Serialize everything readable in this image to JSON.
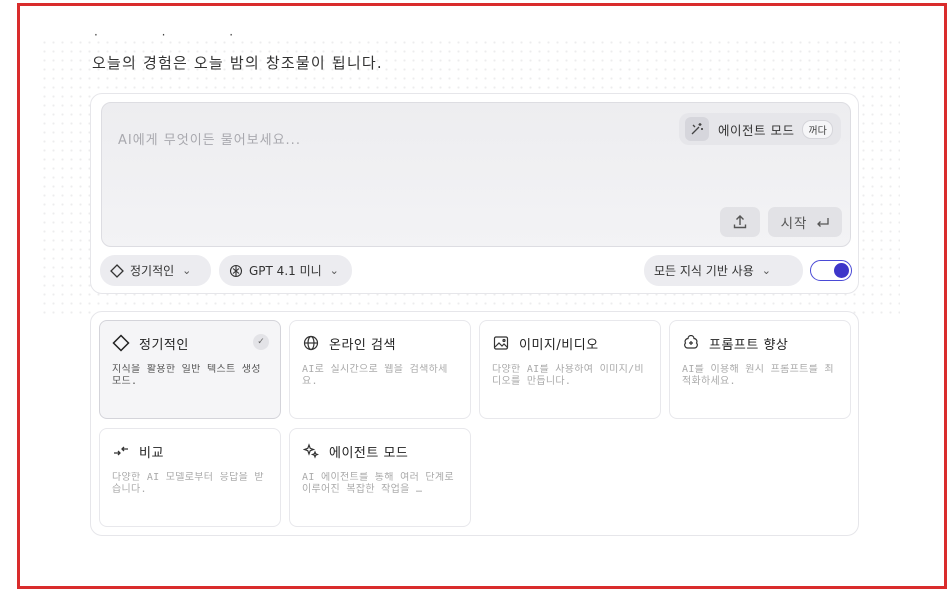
{
  "header": {
    "top_fragment": "· · ·",
    "headline": "오늘의 경험은 오늘 밤의 창조물이 됩니다."
  },
  "prompt": {
    "placeholder": "AI에게 무엇이든 물어보세요...",
    "agent_mode_label": "에이전트 모드",
    "agent_mode_state": "꺼다",
    "start_label": "시작",
    "start_icon": "enter-icon",
    "upload_icon": "upload-icon"
  },
  "controls": {
    "mode_label": "정기적인",
    "model_label": "GPT 4.1 미니",
    "knowledge_label": "모든 지식 기반 사용",
    "toggle_on": true,
    "toggle_color": "#3d36c9"
  },
  "modes": [
    {
      "icon": "diamond-icon",
      "title": "정기적인",
      "desc": "지식을 활용한 일반 텍스트 생성 모드.",
      "selected": true
    },
    {
      "icon": "globe-icon",
      "title": "온라인 검색",
      "desc": "AI로 실시간으로 웹을 검색하세요.",
      "selected": false
    },
    {
      "icon": "image-icon",
      "title": "이미지/비디오",
      "desc": "다양한 AI를 사용하여 이미지/비디오를 만듭니다.",
      "selected": false
    },
    {
      "icon": "sparkle-brain-icon",
      "title": "프롬프트 향상",
      "desc": "AI를 이용해 원시 프롬프트를 최적화하세요.",
      "selected": false
    },
    {
      "icon": "compare-icon",
      "title": "비교",
      "desc": "다양한 AI 모델로부터 응답을 받습니다.",
      "selected": false
    },
    {
      "icon": "agent-sparkle-icon",
      "title": "에이전트 모드",
      "desc": "AI 에이전트를 통해 여러 단계로 이루어진 복잡한 작업을 …",
      "selected": false
    }
  ]
}
